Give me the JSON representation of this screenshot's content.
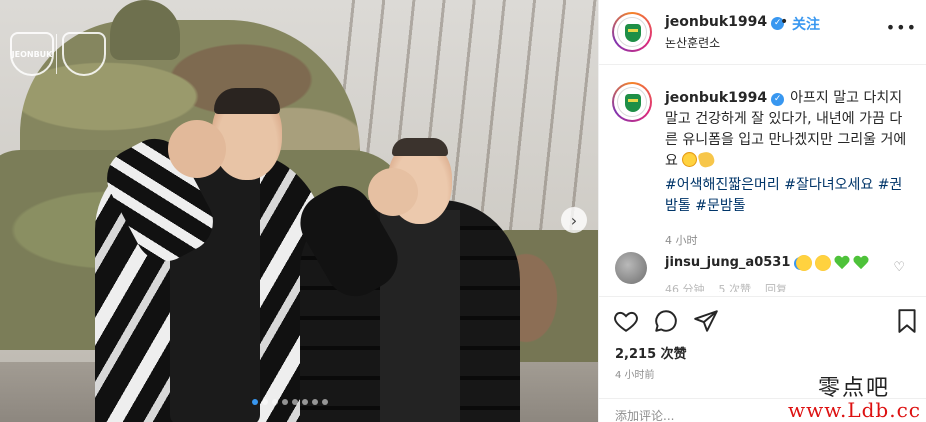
{
  "post": {
    "image_carousel": {
      "slide_count": 8,
      "active_index": 0
    },
    "watermark_logos": [
      "JEONBUK",
      ""
    ]
  },
  "header": {
    "username": "jeonbuk1994",
    "follow_separator": "•",
    "follow_label": "关注",
    "location": "논산훈련소",
    "more_icon": "•••"
  },
  "caption": {
    "username": "jeonbuk1994",
    "text": "아프지 말고 다치지 말고 건강하게 잘 있다가, 내년에 가끔 다른 유니폼을 입고 만나겠지만 그리울 거에요",
    "hashtags": [
      "#어색해진짧은머리",
      "#잘다녀오세요",
      "#권밤톨",
      "#문밤톨"
    ],
    "time": "4 小时"
  },
  "comment": {
    "username": "jinsu_jung_a0531",
    "meta": [
      "46 分钟",
      "5 次赞",
      "回复"
    ],
    "like_icon": "♡"
  },
  "actions": {
    "like_icon": "heart-outline",
    "comment_icon": "speech-bubble",
    "share_icon": "paper-plane",
    "save_icon": "bookmark"
  },
  "likes": "2,215 次赞",
  "post_time": "4 小时前",
  "comment_input": {
    "placeholder": "添加评论..."
  },
  "watermark": {
    "line1": "零点吧",
    "line2": "www.Ldb.cc"
  },
  "colors": {
    "link": "#3897f0",
    "hashtag": "#003569",
    "verified": "#3897f0",
    "muted": "#8e8e8e"
  }
}
